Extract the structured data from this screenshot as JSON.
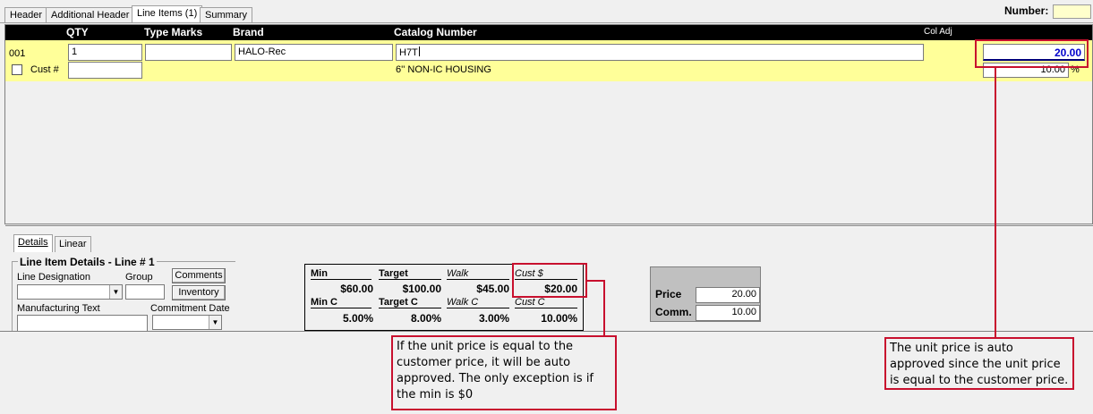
{
  "tabs": [
    "Header",
    "Additional Header",
    "Line Items (1)",
    "Summary"
  ],
  "number_label": "Number:",
  "columns": {
    "qty": "QTY",
    "type_marks": "Type Marks",
    "brand": "Brand",
    "catalog_number": "Catalog Number",
    "col_adj": "Col Adj"
  },
  "line": {
    "line_no": "001",
    "qty": "1",
    "type_marks": "",
    "brand": "HALO-Rec",
    "catalog_number": "H7T",
    "description": "6'' NON-IC HOUSING",
    "cust_label": "Cust #",
    "cust_value": "",
    "unit_price": "20.00",
    "comm_value": "10.00",
    "percent_sign": "%"
  },
  "sub_tabs": [
    "Details",
    "Linear"
  ],
  "details": {
    "group_title": "Line Item Details - Line # 1",
    "line_designation_label": "Line Designation",
    "group_label": "Group",
    "comments_button": "Comments",
    "inventory_button": "Inventory",
    "manufacturing_text_label": "Manufacturing Text",
    "commitment_date_label": "Commitment Date"
  },
  "pricing": {
    "headers_row1": [
      "Min",
      "Target",
      "Walk",
      "Cust $"
    ],
    "values_row1": [
      "$60.00",
      "$100.00",
      "$45.00",
      "$20.00"
    ],
    "headers_row2": [
      "Min C",
      "Target C",
      "Walk C",
      "Cust C"
    ],
    "values_row2": [
      "5.00%",
      "8.00%",
      "3.00%",
      "10.00%"
    ]
  },
  "price_box": {
    "price_label": "Price",
    "price_value": "20.00",
    "comm_label": "Comm.",
    "comm_value": "10.00"
  },
  "annotations": {
    "left_callout": "If the unit price is equal to the customer price, it will be auto approved. The only exception is if the min is  $0",
    "right_callout": "The unit price is auto approved since the unit price is equal to the customer price.",
    "highlight_color": "#c8102e"
  },
  "colors": {
    "row_highlight": "#ffff99",
    "unit_price_text": "#0000cc",
    "header_bar": "#000000"
  }
}
